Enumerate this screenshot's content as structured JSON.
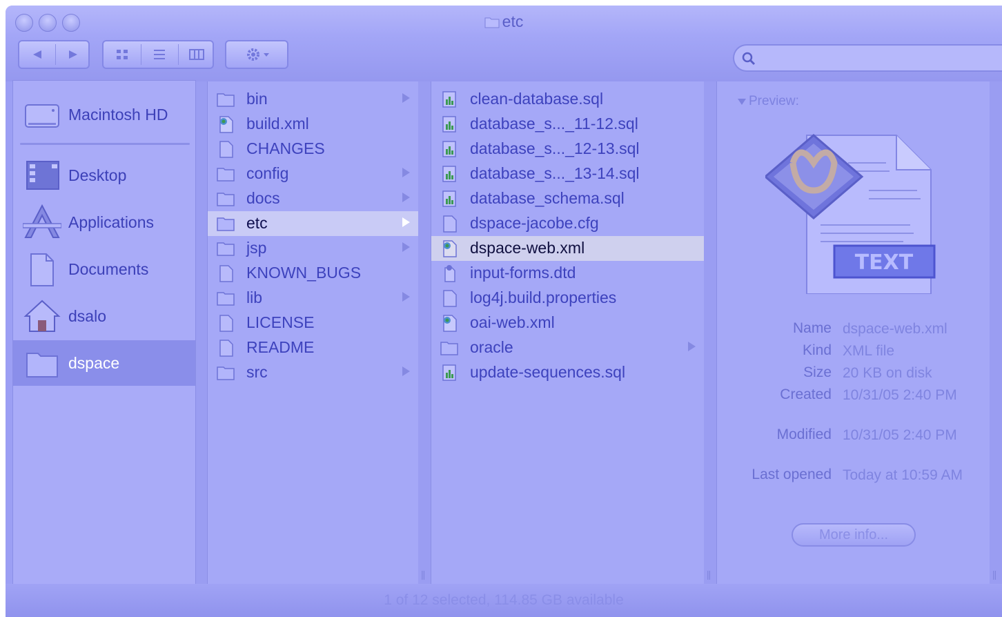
{
  "window": {
    "title": "etc"
  },
  "toolbar": {
    "view_modes": [
      "icon-view",
      "list-view",
      "column-view"
    ],
    "action_menu": "gear-icon"
  },
  "search": {
    "value": "",
    "placeholder": ""
  },
  "sidebar": {
    "devices": [
      {
        "label": "Macintosh HD",
        "icon": "hard-drive-icon"
      }
    ],
    "places": [
      {
        "label": "Desktop",
        "icon": "desktop-icon"
      },
      {
        "label": "Applications",
        "icon": "applications-icon"
      },
      {
        "label": "Documents",
        "icon": "documents-icon"
      },
      {
        "label": "dsalo",
        "icon": "home-icon"
      },
      {
        "label": "dspace",
        "icon": "folder-icon",
        "selected": true
      }
    ]
  },
  "column1": {
    "items": [
      {
        "label": "bin",
        "kind": "folder"
      },
      {
        "label": "build.xml",
        "kind": "xml"
      },
      {
        "label": "CHANGES",
        "kind": "doc"
      },
      {
        "label": "config",
        "kind": "folder"
      },
      {
        "label": "docs",
        "kind": "folder"
      },
      {
        "label": "etc",
        "kind": "folder",
        "selected": true
      },
      {
        "label": "jsp",
        "kind": "folder"
      },
      {
        "label": "KNOWN_BUGS",
        "kind": "doc"
      },
      {
        "label": "lib",
        "kind": "folder"
      },
      {
        "label": "LICENSE",
        "kind": "doc"
      },
      {
        "label": "README",
        "kind": "doc"
      },
      {
        "label": "src",
        "kind": "folder"
      }
    ]
  },
  "column2": {
    "items": [
      {
        "label": "clean-database.sql",
        "kind": "sql"
      },
      {
        "label": "database_s..._11-12.sql",
        "kind": "sql"
      },
      {
        "label": "database_s..._12-13.sql",
        "kind": "sql"
      },
      {
        "label": "database_s..._13-14.sql",
        "kind": "sql"
      },
      {
        "label": "database_schema.sql",
        "kind": "sql"
      },
      {
        "label": "dspace-jacobe.cfg",
        "kind": "doc"
      },
      {
        "label": "dspace-web.xml",
        "kind": "xml",
        "selected": true
      },
      {
        "label": "input-forms.dtd",
        "kind": "dtd"
      },
      {
        "label": "log4j.build.properties",
        "kind": "doc"
      },
      {
        "label": "oai-web.xml",
        "kind": "xml"
      },
      {
        "label": "oracle",
        "kind": "folder"
      },
      {
        "label": "update-sequences.sql",
        "kind": "sql"
      }
    ]
  },
  "preview": {
    "header": "Preview:",
    "badge": "TEXT",
    "info": [
      {
        "key": "Name",
        "value": "dspace-web.xml"
      },
      {
        "key": "Kind",
        "value": "XML file"
      },
      {
        "key": "Size",
        "value": "20 KB on disk"
      },
      {
        "key": "Created",
        "value": "10/31/05 2:40 PM"
      },
      {
        "key": "Modified",
        "value": "10/31/05 2:40 PM"
      },
      {
        "key": "Last opened",
        "value": "Today at 10:59 AM"
      }
    ],
    "more_button": "More info..."
  },
  "status": {
    "text": "1 of 12 selected, 114.85 GB available"
  },
  "colors": {
    "tint": "#9c9ff4",
    "text": "#3d42bd",
    "selection": "#c9cbf6"
  }
}
